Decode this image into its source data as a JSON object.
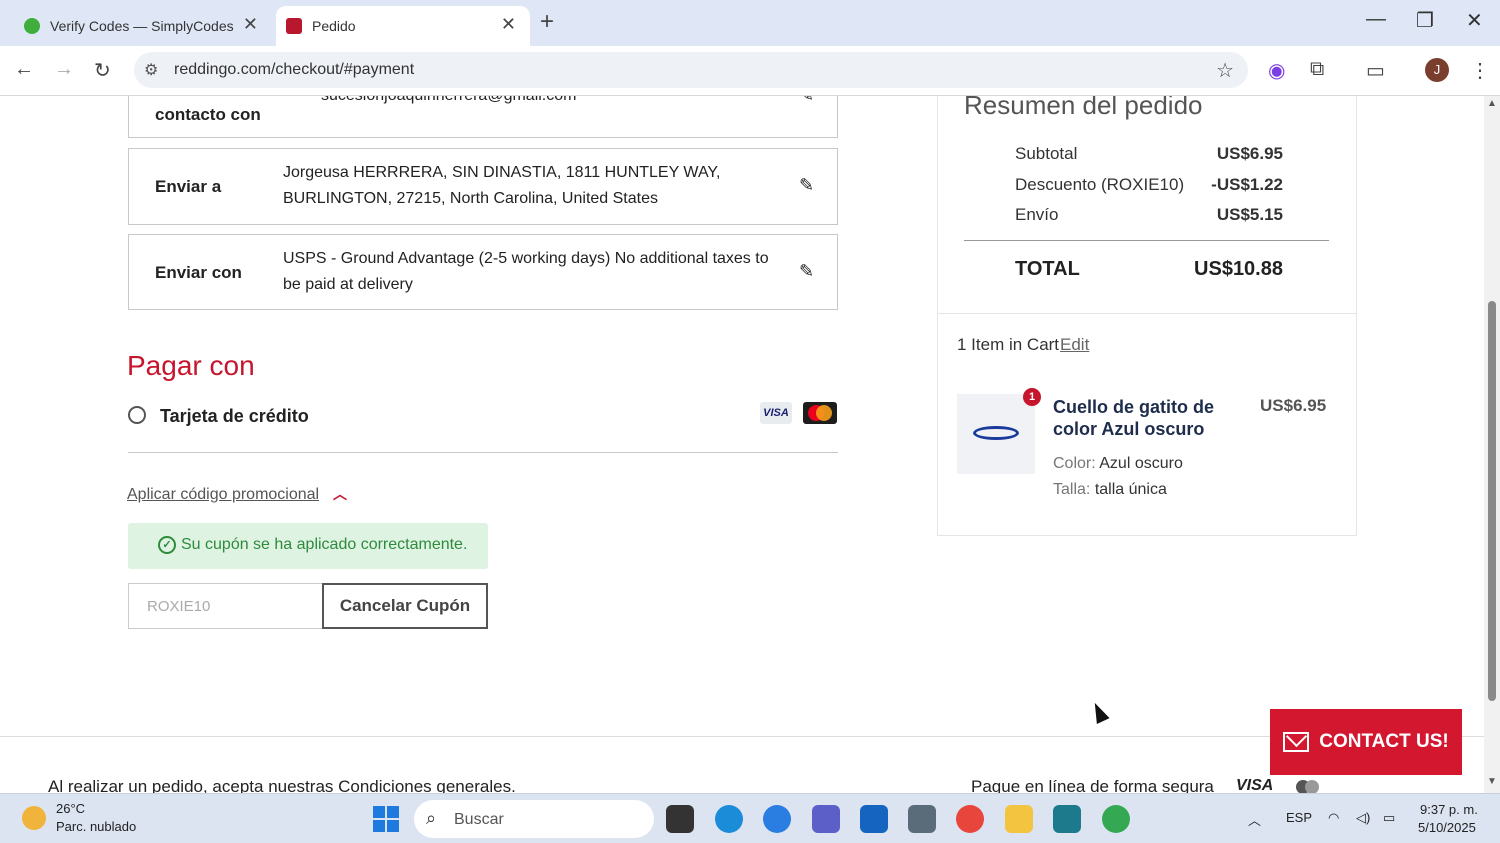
{
  "browser": {
    "tabs": [
      {
        "title": "Verify Codes — SimplyCodes"
      },
      {
        "title": "Pedido"
      }
    ],
    "url": "reddingo.com/checkout/#payment",
    "profile_initial": "J"
  },
  "checkout": {
    "contact": {
      "label": "contacto con",
      "value": "sucesionjoaquinherrera@gmail.com"
    },
    "ship_to": {
      "label": "Enviar a",
      "value": "Jorgeusa HERRRERA, SIN DINASTIA, 1811 HUNTLEY WAY, BURLINGTON, 27215, North Carolina, United States"
    },
    "ship_with": {
      "label": "Enviar con",
      "value": "USPS - Ground Advantage (2-5 working days) No additional taxes to be paid at delivery"
    },
    "pay_title": "Pagar con",
    "payment_option": "Tarjeta de crédito",
    "visa_text": "VISA",
    "promo_link": "Aplicar código promocional",
    "promo_success": "Su cupón se ha aplicado correctamente.",
    "coupon_code": "ROXIE10",
    "cancel_coupon": "Cancelar Cupón"
  },
  "summary": {
    "title": "Resumen del pedido",
    "rows": [
      {
        "label": "Subtotal",
        "value": "US$6.95"
      },
      {
        "label": "Descuento (ROXIE10)",
        "value": "-US$1.22"
      },
      {
        "label": "Envío",
        "value": "US$5.15"
      }
    ],
    "total_label": "TOTAL",
    "total_value": "US$10.88",
    "items_count": "1 Item in Cart",
    "edit": "Edit",
    "product": {
      "qty_badge": "1",
      "name": "Cuello de gatito de color Azul oscuro",
      "price": "US$6.95",
      "color_label": "Color:",
      "color_value": "Azul oscuro",
      "size_label": "Talla:",
      "size_value": "talla única"
    }
  },
  "footer": {
    "left": "Al realizar un pedido, acepta nuestras Condiciones generales.",
    "right": "Pague en línea de forma segura",
    "visa": "VISA"
  },
  "contact_button": "CONTACT US!",
  "taskbar": {
    "temperature": "26°C",
    "weather": "Parc. nublado",
    "search_placeholder": "Buscar",
    "language": "ESP",
    "time": "9:37 p. m.",
    "date": "5/10/2025"
  },
  "colors": {
    "brand_red": "#c5162e",
    "success_green": "#2e8b3d",
    "product_blue": "#1f2d4d"
  }
}
